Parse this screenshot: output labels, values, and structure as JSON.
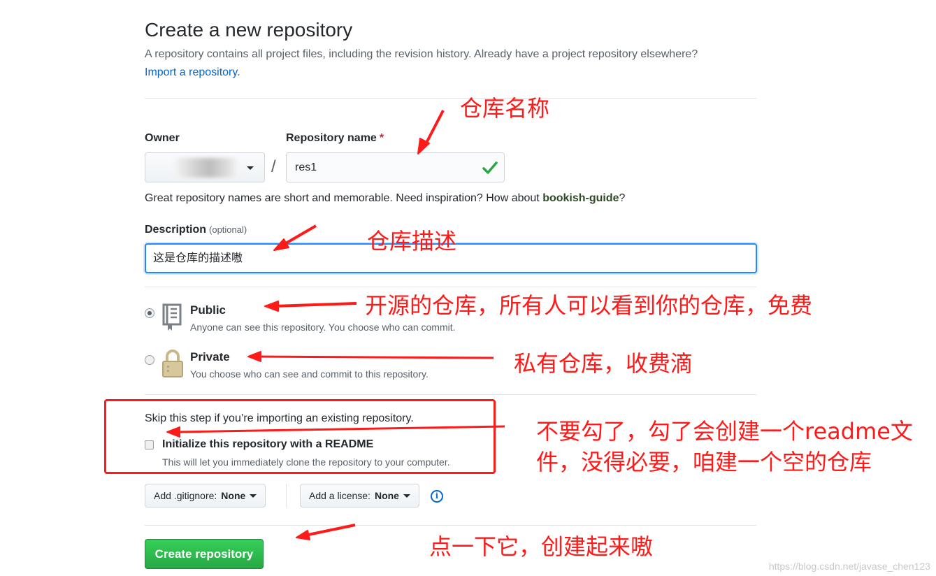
{
  "header": {
    "title": "Create a new repository",
    "subtitle": "A repository contains all project files, including the revision history. Already have a project repository elsewhere?",
    "import_link": "Import a repository."
  },
  "owner": {
    "label": "Owner"
  },
  "repo_name": {
    "label": "Repository name",
    "required_mark": "*",
    "value": "res1",
    "separator": "/"
  },
  "hint": {
    "prefix": "Great repository names are short and memorable. Need inspiration? How about ",
    "suggestion": "bookish-guide",
    "suffix": "?"
  },
  "description": {
    "label": "Description",
    "optional": "(optional)",
    "value": "这是仓库的描述嗷"
  },
  "visibility": {
    "public": {
      "title": "Public",
      "desc": "Anyone can see this repository. You choose who can commit.",
      "checked": true
    },
    "private": {
      "title": "Private",
      "desc": "You choose who can see and commit to this repository.",
      "checked": false
    }
  },
  "init": {
    "skip_text": "Skip this step if you’re importing an existing repository.",
    "readme_label": "Initialize this repository with a README",
    "readme_desc": "This will let you immediately clone the repository to your computer.",
    "checked": false
  },
  "gitignore": {
    "prefix": "Add .gitignore: ",
    "value": "None"
  },
  "license": {
    "prefix": "Add a license: ",
    "value": "None"
  },
  "info_icon": "i",
  "create_button": "Create repository",
  "annotations": {
    "repo_name": "仓库名称",
    "description": "仓库描述",
    "public": "开源的仓库，所有人可以看到你的仓库，免费",
    "private": "私有仓库，收费滴",
    "readme_line1": "不要勾了，勾了会创建一个readme文",
    "readme_line2": "件，没得必要，咱建一个空的仓库",
    "create": "点一下它，创建起来嗷"
  },
  "watermark": "https://blog.csdn.net/javase_chen123",
  "colors": {
    "annotation_red": "#ff1a1a",
    "link_blue": "#0366d6",
    "create_green": "#28a745",
    "focus_blue": "#2188ff"
  },
  "icons": {
    "check": "check-icon",
    "public": "repo-book-icon",
    "private": "lock-icon",
    "info": "info-icon"
  }
}
